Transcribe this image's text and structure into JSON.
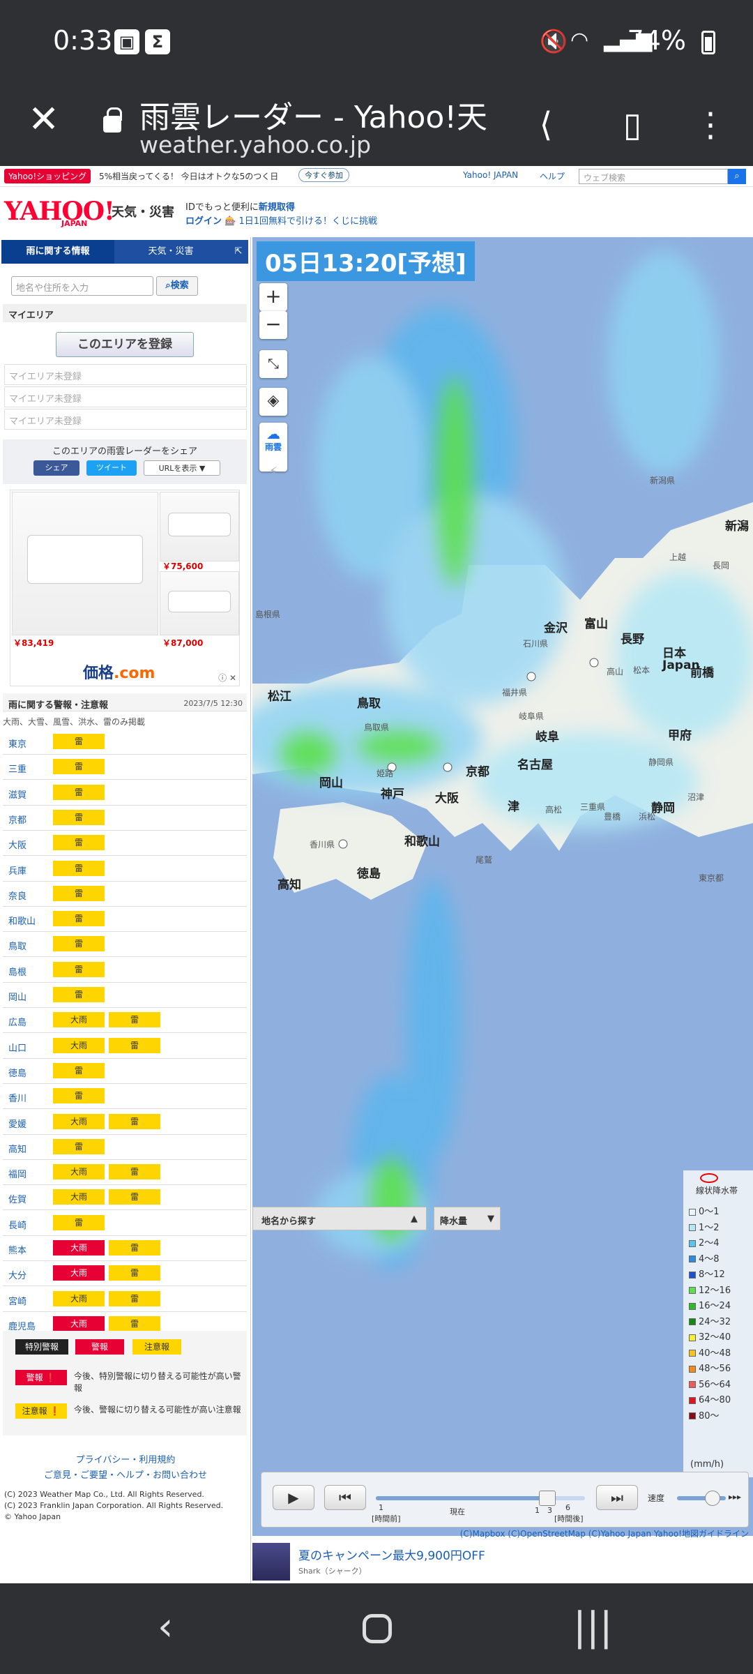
{
  "status": {
    "time": "0:33",
    "battery": "74%"
  },
  "browser": {
    "title": "雨雲レーダー - Yahoo!天...",
    "url": "weather.yahoo.co.jp"
  },
  "yahoo_top": {
    "shop_label": "Yahoo!ショッピング",
    "ad_text": "5%相当戻ってくる！ 今日はオトクな5のつく日",
    "join_label": "今すぐ参加",
    "links": [
      "Yahoo! JAPAN",
      "ヘルプ"
    ],
    "search_placeholder": "ウェブ検索"
  },
  "header": {
    "logo": "YAHOO!",
    "logo_sub": "JAPAN",
    "service": "天気・災害",
    "promo1": "IDでもっと便利に",
    "promo1_link": "新規取得",
    "login": "ログイン",
    "promo2": "1日1回無料で引ける！くじに挑戦"
  },
  "sidebar": {
    "tabs": [
      "雨に関する情報",
      "天気・災害",
      "⇱"
    ],
    "search_placeholder": "地名や住所を入力",
    "search_button": "検索",
    "myarea_title": "マイエリア",
    "register_button": "このエリアを登録",
    "myarea_rows": [
      "マイエリア未登録",
      "マイエリア未登録",
      "マイエリア未登録"
    ],
    "share_label": "このエリアの雨雲レーダーをシェア",
    "share_buttons": [
      "シェア",
      "ツイート",
      "URLを表示 ▼"
    ],
    "ad": {
      "prices": [
        "￥75,600",
        "￥83,419",
        "￥87,000"
      ],
      "brand": "価格",
      "brand_suffix": ".com",
      "close": "ⓘ ✕"
    },
    "warnings": {
      "title": "雨に関する警報・注意報",
      "date": "2023/7/5 12:30",
      "subtitle": "大雨、大雪、風雪、洪水、雷のみ掲載",
      "rows": [
        {
          "pref": "東京",
          "tags": [
            {
              "t": "雷",
              "c": "y"
            }
          ]
        },
        {
          "pref": "三重",
          "tags": [
            {
              "t": "雷",
              "c": "y"
            }
          ]
        },
        {
          "pref": "滋賀",
          "tags": [
            {
              "t": "雷",
              "c": "y"
            }
          ]
        },
        {
          "pref": "京都",
          "tags": [
            {
              "t": "雷",
              "c": "y"
            }
          ]
        },
        {
          "pref": "大阪",
          "tags": [
            {
              "t": "雷",
              "c": "y"
            }
          ]
        },
        {
          "pref": "兵庫",
          "tags": [
            {
              "t": "雷",
              "c": "y"
            }
          ]
        },
        {
          "pref": "奈良",
          "tags": [
            {
              "t": "雷",
              "c": "y"
            }
          ]
        },
        {
          "pref": "和歌山",
          "tags": [
            {
              "t": "雷",
              "c": "y"
            }
          ]
        },
        {
          "pref": "鳥取",
          "tags": [
            {
              "t": "雷",
              "c": "y"
            }
          ]
        },
        {
          "pref": "島根",
          "tags": [
            {
              "t": "雷",
              "c": "y"
            }
          ]
        },
        {
          "pref": "岡山",
          "tags": [
            {
              "t": "雷",
              "c": "y"
            }
          ]
        },
        {
          "pref": "広島",
          "tags": [
            {
              "t": "大雨",
              "c": "y"
            },
            {
              "t": "雷",
              "c": "y"
            }
          ]
        },
        {
          "pref": "山口",
          "tags": [
            {
              "t": "大雨",
              "c": "y"
            },
            {
              "t": "雷",
              "c": "y"
            }
          ]
        },
        {
          "pref": "徳島",
          "tags": [
            {
              "t": "雷",
              "c": "y"
            }
          ]
        },
        {
          "pref": "香川",
          "tags": [
            {
              "t": "雷",
              "c": "y"
            }
          ]
        },
        {
          "pref": "愛媛",
          "tags": [
            {
              "t": "大雨",
              "c": "y"
            },
            {
              "t": "雷",
              "c": "y"
            }
          ]
        },
        {
          "pref": "高知",
          "tags": [
            {
              "t": "雷",
              "c": "y"
            }
          ]
        },
        {
          "pref": "福岡",
          "tags": [
            {
              "t": "大雨",
              "c": "y"
            },
            {
              "t": "雷",
              "c": "y"
            }
          ]
        },
        {
          "pref": "佐賀",
          "tags": [
            {
              "t": "大雨",
              "c": "y"
            },
            {
              "t": "雷",
              "c": "y"
            }
          ]
        },
        {
          "pref": "長崎",
          "tags": [
            {
              "t": "雷",
              "c": "y"
            }
          ]
        },
        {
          "pref": "熊本",
          "tags": [
            {
              "t": "大雨",
              "c": "r"
            },
            {
              "t": "雷",
              "c": "y"
            }
          ]
        },
        {
          "pref": "大分",
          "tags": [
            {
              "t": "大雨",
              "c": "r"
            },
            {
              "t": "雷",
              "c": "y"
            }
          ]
        },
        {
          "pref": "宮崎",
          "tags": [
            {
              "t": "大雨",
              "c": "y"
            },
            {
              "t": "雷",
              "c": "y"
            }
          ]
        },
        {
          "pref": "鹿児島",
          "tags": [
            {
              "t": "大雨",
              "c": "r"
            },
            {
              "t": "雷",
              "c": "y"
            }
          ]
        }
      ]
    },
    "legend": {
      "special": "特別警報",
      "warning": "警報",
      "advisory": "注意報",
      "warning_note_tag": "警報 ❗",
      "warning_note": "今後、特別警報に切り替える可能性が高い警報",
      "advisory_note_tag": "注意報 ❗",
      "advisory_note": "今後、警報に切り替える可能性が高い注意報"
    },
    "footer": {
      "link1": "プライバシー・利用規約",
      "link2": "ご意見・ご要望・ヘルプ・お問い合わせ",
      "copy1": "(C) 2023 Weather Map Co., Ltd. All Rights Reserved.",
      "copy2": "(C) 2023 Franklin Japan Corporation. All Rights Reserved.",
      "copy3": "© Yahoo Japan"
    }
  },
  "map": {
    "timestamp": "05日13:20[予想]",
    "rain_label": "雨雲",
    "cities": [
      "新潟県",
      "上越",
      "新潟",
      "長岡",
      "金沢",
      "富山",
      "長野",
      "石川県",
      "日本",
      "Japan",
      "福井県",
      "高山",
      "松本",
      "前橋",
      "島根県",
      "松江",
      "鳥取",
      "岐阜県",
      "甲府",
      "岐阜",
      "姫路",
      "京都",
      "名古屋",
      "岡山",
      "神戸",
      "大阪",
      "津",
      "静岡",
      "沼津",
      "高松",
      "豊橋",
      "浜松",
      "静岡県",
      "和歌山",
      "徳島",
      "尾鷲",
      "東京都",
      "高知",
      "香川県",
      "鳥取県",
      "三重県"
    ],
    "rain_legend": {
      "title": "線状降水帯",
      "items": [
        {
          "label": "0〜1",
          "color": "#e9f7fb"
        },
        {
          "label": "1〜2",
          "color": "#b3e7f5"
        },
        {
          "label": "2〜4",
          "color": "#5bc4ee"
        },
        {
          "label": "4〜8",
          "color": "#2a8be3"
        },
        {
          "label": "8〜12",
          "color": "#1f4fd1"
        },
        {
          "label": "12〜16",
          "color": "#5ce04c"
        },
        {
          "label": "16〜24",
          "color": "#2dbb2a"
        },
        {
          "label": "24〜32",
          "color": "#148a14"
        },
        {
          "label": "32〜40",
          "color": "#f5f034"
        },
        {
          "label": "40〜48",
          "color": "#f4c31c"
        },
        {
          "label": "48〜56",
          "color": "#f38a1a"
        },
        {
          "label": "56〜64",
          "color": "#ef5b5b"
        },
        {
          "label": "64〜80",
          "color": "#e0151e"
        },
        {
          "label": "80〜",
          "color": "#8a0a1a"
        }
      ],
      "unit": "(mm/h)"
    },
    "place_search": "地名から探す",
    "rain_amount": "降水量",
    "player": {
      "speed": "速度",
      "t1": "1",
      "t1_label": "[時間前]",
      "now": "現在",
      "t2": "1",
      "t3": "3",
      "t4": "6",
      "t4_label": "[時間後]"
    },
    "attribution": "(C)Mapbox (C)OpenStreetMap (C)Yahoo Japan Yahoo!地図ガイドライン",
    "promo_title": "夏のキャンペーン最大9,900円OFF",
    "promo_sub": "Shark（シャーク）"
  }
}
